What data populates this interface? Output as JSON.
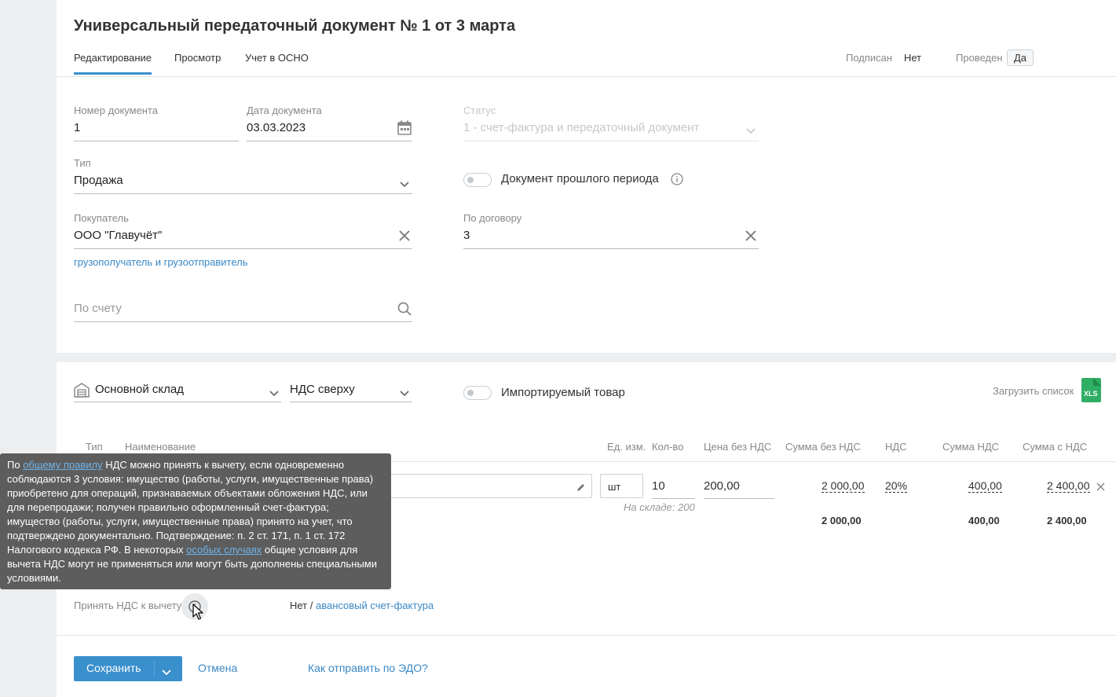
{
  "header": {
    "title": "Универсальный передаточный документ № 1 от 3 марта",
    "tabs": [
      "Редактирование",
      "Просмотр",
      "Учет в ОСНО"
    ],
    "signed_label": "Подписан",
    "signed_value": "Нет",
    "posted_label": "Проведен",
    "posted_value": "Да"
  },
  "form": {
    "doc_number_label": "Номер документа",
    "doc_number_value": "1",
    "doc_date_label": "Дата документа",
    "doc_date_value": "03.03.2023",
    "status_label": "Статус",
    "status_value": "1 - счет-фактура и передаточный документ",
    "type_label": "Тип",
    "type_value": "Продажа",
    "past_period_label": "Документ прошлого периода",
    "buyer_label": "Покупатель",
    "buyer_value": "ООО \"Главучёт\"",
    "contract_label": "По договору",
    "contract_value": "3",
    "consignee_link": "грузополучатель и грузоотправитель",
    "invoice_placeholder": "По счету"
  },
  "goods": {
    "warehouse_value": "Основной склад",
    "vat_mode_value": "НДС сверху",
    "imported_label": "Импортируемый товар",
    "upload_label": "Загрузить список",
    "xls_label": "XLS",
    "columns": [
      "Тип",
      "Наименование",
      "Ед. изм.",
      "Кол-во",
      "Цена без НДС",
      "Сумма без НДС",
      "НДС",
      "Сумма НДС",
      "Сумма с НДС"
    ],
    "row": {
      "unit": "шт",
      "qty": "10",
      "price": "200,00",
      "sum_no_vat": "2 000,00",
      "vat_rate": "20%",
      "vat_sum": "400,00",
      "sum_with_vat": "2 400,00",
      "stock_hint": "На складе: 200"
    },
    "totals": {
      "sum_no_vat": "2 000,00",
      "vat_sum": "400,00",
      "sum_with_vat": "2 400,00"
    }
  },
  "vat_deduction": {
    "label": "Принять НДС к вычету",
    "value_no": "Нет",
    "separator": " / ",
    "advance_link": "авансовый счет-фактура"
  },
  "tooltip": {
    "p1": "По ",
    "link1": "общему правилу",
    "p2": " НДС можно принять к вычету, если одновременно соблюдаются 3 условия: имущество (работы, услуги, имущественные права) приобретено для операций, признаваемых объектами обложения НДС, или для перепродажи; получен правильно оформленный счет-фактура; имущество (работы, услуги, имущественные права) принято на учет, что подтверждено документально. Подтверждение: п. 2 ст. 171, п. 1 ст. 172 Налогового кодекса РФ. В некоторых ",
    "link2": "особых случаях",
    "p3": " общие условия для вычета НДС могут не применяться или могут быть дополнены специальными условиями."
  },
  "footer": {
    "save_label": "Сохранить",
    "cancel_label": "Отмена",
    "edo_link": "Как отправить по ЭДО?"
  },
  "colors": {
    "accent": "#3a8fcd",
    "link": "#3a88c5",
    "xls": "#2fae64",
    "tooltip_bg": "#5d5d5d"
  }
}
